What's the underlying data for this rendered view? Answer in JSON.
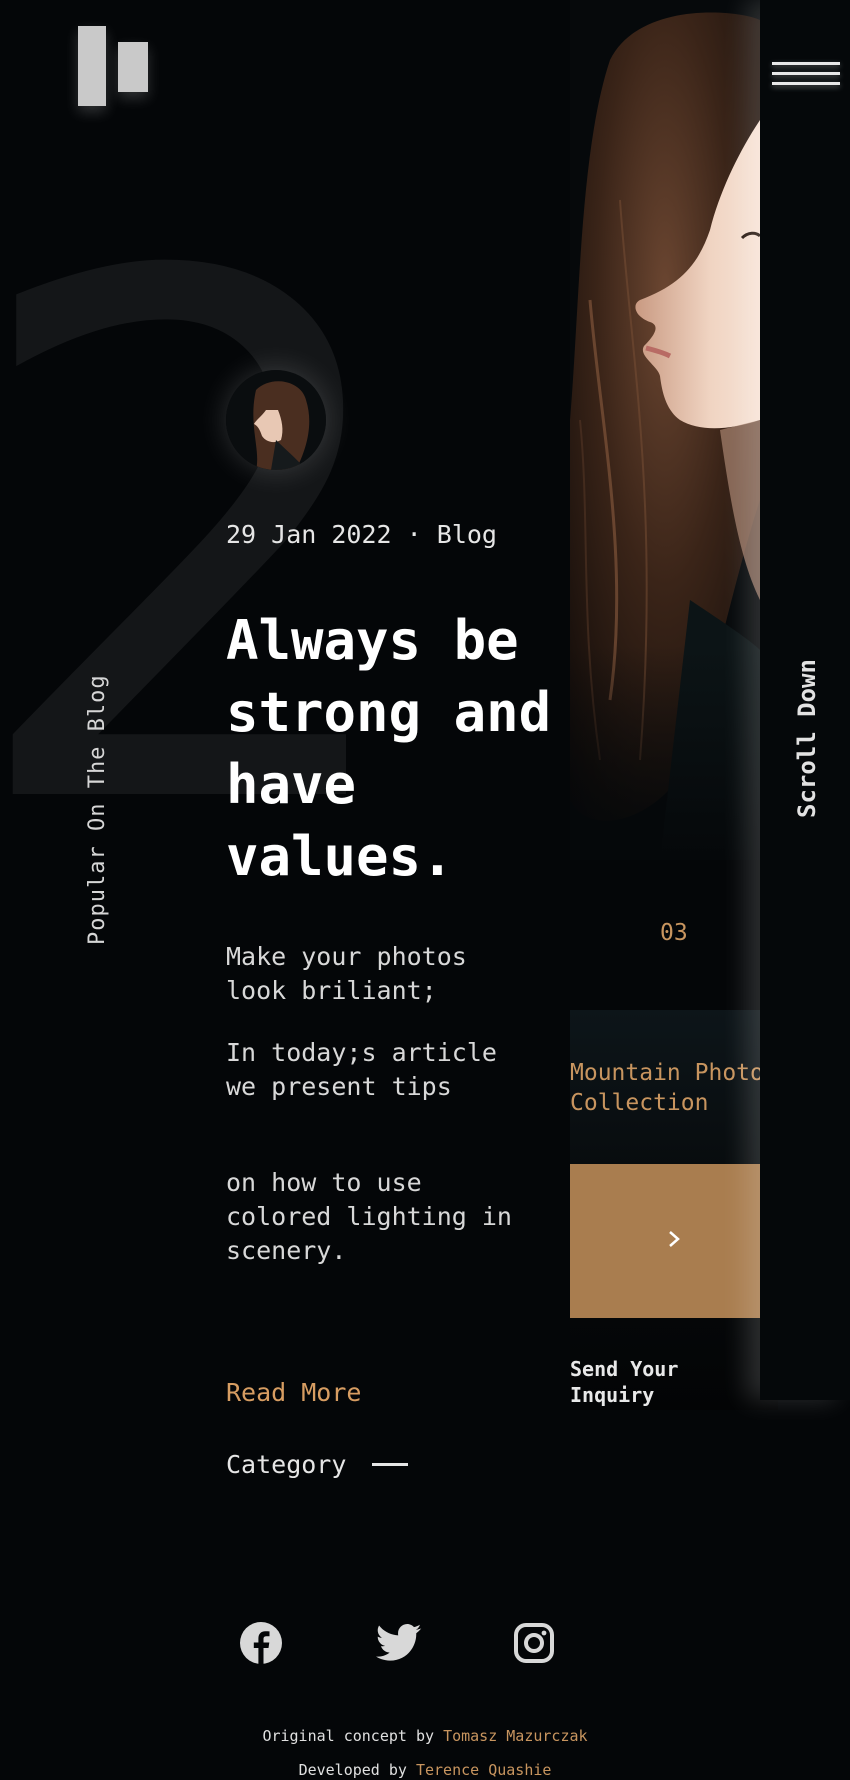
{
  "logo": {
    "icon": "logo-bars-icon"
  },
  "background_number": "2",
  "sidebar": {
    "vertical_label": "Popular On The Blog"
  },
  "menu": {
    "icon": "hamburger-menu-icon"
  },
  "scroll": {
    "label": "Scroll Down"
  },
  "article": {
    "date": "29 Jan 2022",
    "separator": "·",
    "category_tag": "Blog",
    "headline": "Always be strong and have values.",
    "excerpt": [
      "Make your photos look briliant;",
      "In today;s article we present tips",
      "on how to use colored lighting in scenery."
    ],
    "read_more": "Read More",
    "category_label": "Category"
  },
  "slider": {
    "number": "03",
    "card_title": "Mountain Photo Collection",
    "next_icon": "chevron-right-icon",
    "cta": "Send Your Inquiry"
  },
  "social": [
    {
      "name": "facebook",
      "icon": "facebook-icon"
    },
    {
      "name": "twitter",
      "icon": "twitter-icon"
    },
    {
      "name": "instagram",
      "icon": "instagram-icon"
    }
  ],
  "footer": {
    "concept_prefix": "Original concept by",
    "concept_author": "Tomasz Mazurczak",
    "developer_prefix": "Developed by",
    "developer_author": "Terence Quashie"
  },
  "colors": {
    "background": "#040608",
    "accent": "#c8955f",
    "button": "#a97d4f",
    "text": "#e6e6e6"
  }
}
